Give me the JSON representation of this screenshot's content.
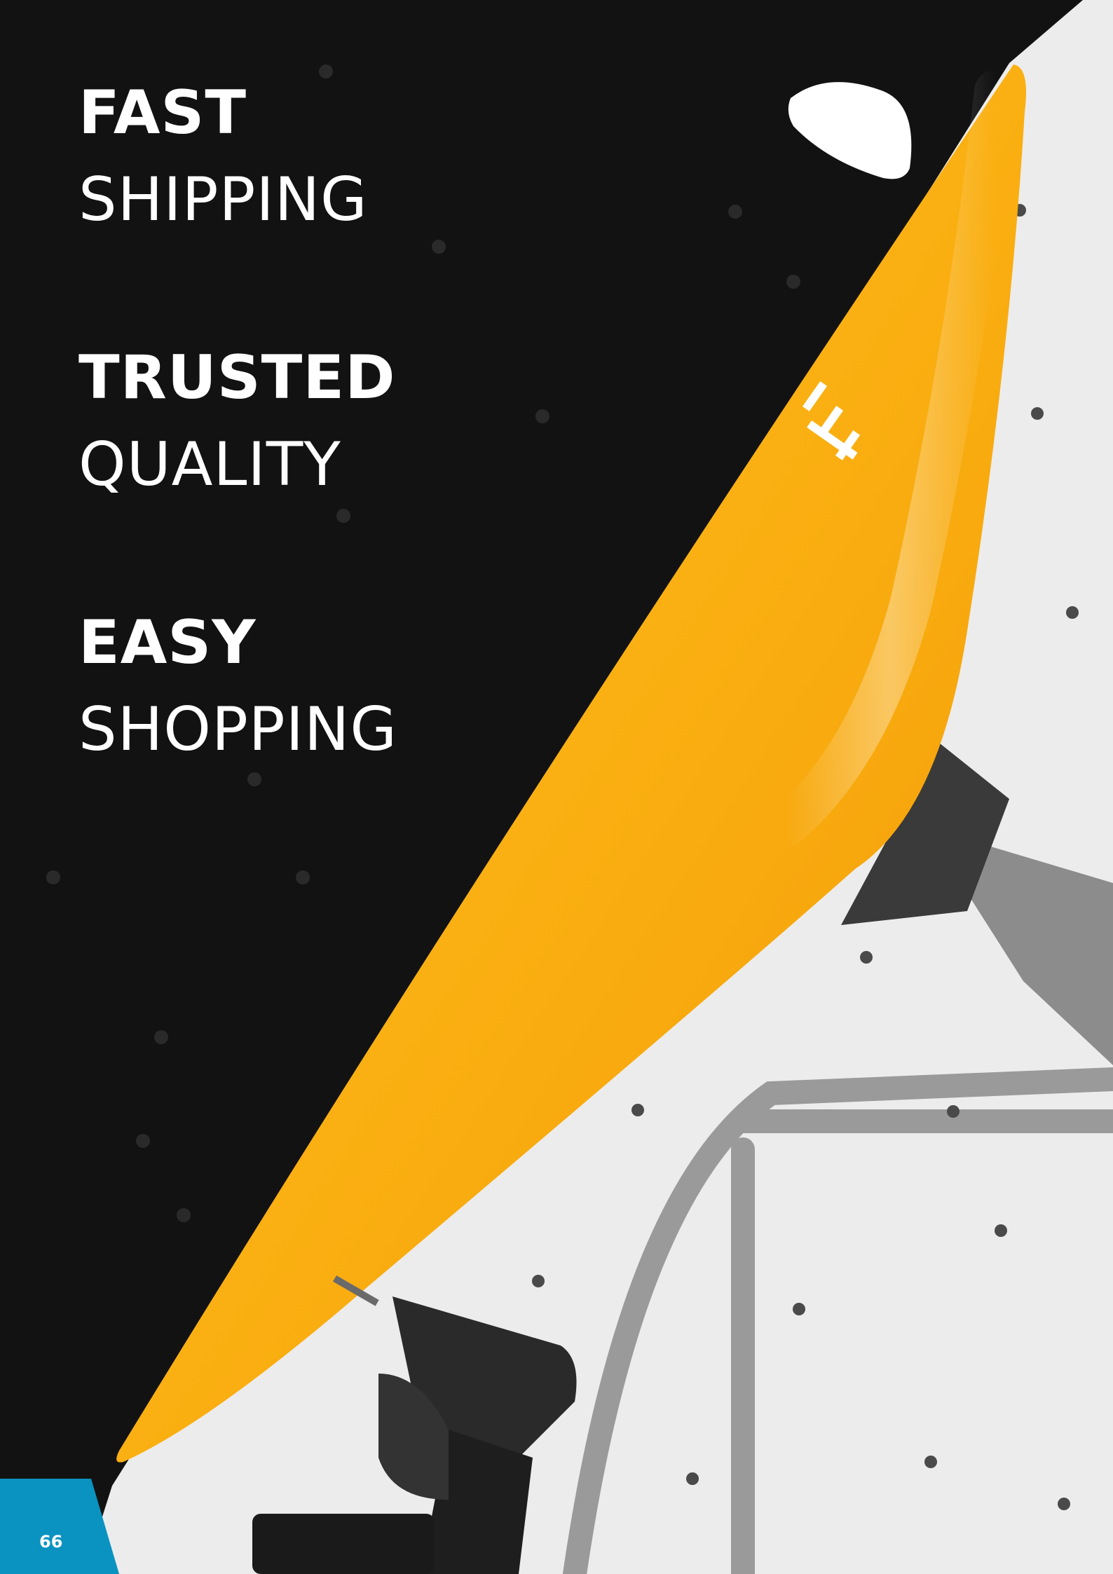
{
  "headlines": [
    {
      "bold": "FAST",
      "light": "SHIPPING"
    },
    {
      "bold": "TRUSTED",
      "light": "QUALITY"
    },
    {
      "bold": "EASY",
      "light": "SHOPPING"
    }
  ],
  "page_number": "66",
  "colors": {
    "wall_black": "#121212",
    "hold_yellow": "#fbb213",
    "tab_blue": "#0a93c0",
    "background_light": "#ececec"
  },
  "icons": [
    "climbing-hold",
    "brand-logo-on-hold",
    "power-drill",
    "ladder"
  ]
}
